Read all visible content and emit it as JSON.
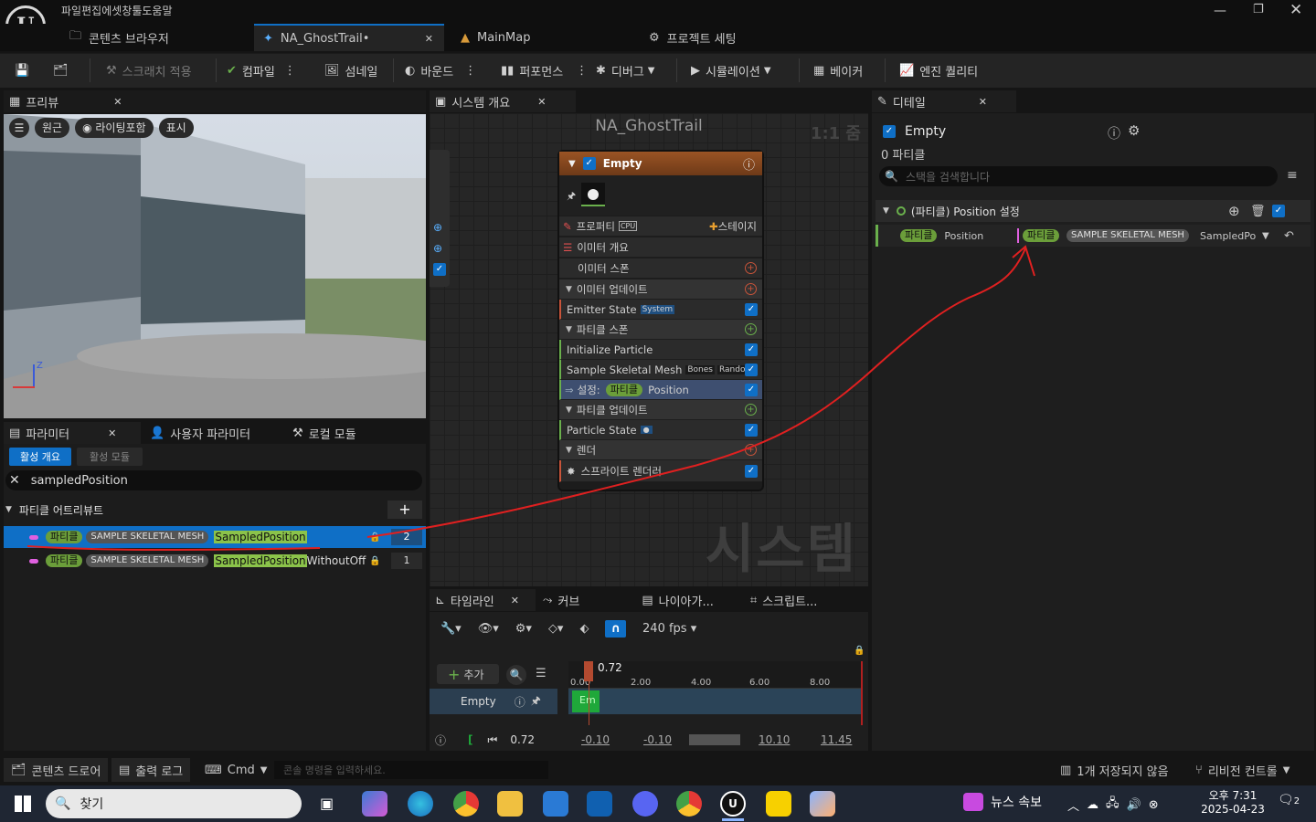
{
  "menu": [
    "파일",
    "편집",
    "에셋",
    "창",
    "툴",
    "도움말"
  ],
  "tabs": {
    "content_browser": "콘텐츠 브라우저",
    "active": "NA_GhostTrail•",
    "mainmap": "MainMap",
    "project_settings": "프로젝트 세팅"
  },
  "toolbar": {
    "scratch": "스크래치 적용",
    "compile": "컴파일",
    "thumbnail": "섬네일",
    "bounds": "바운드",
    "performance": "퍼포먼스",
    "debug": "디버그",
    "simulation": "시뮬레이션",
    "baker": "베이커",
    "engine_quality": "엔진 퀄리티"
  },
  "preview": {
    "tab": "프리뷰",
    "btn_perspective": "원근",
    "btn_lighting": "라이팅포함",
    "btn_show": "표시",
    "axis_z": "Z"
  },
  "params": {
    "tab_params": "파라미터",
    "tab_user": "사용자 파라미터",
    "tab_local": "로컬 모듈",
    "sub_active_overview": "활성 개요",
    "sub_active_modules": "활성 모듈",
    "search_value": "sampledPosition",
    "section": "파티클 어트리뷰트",
    "rows": [
      {
        "ns": "파티클",
        "src": "SAMPLE SKELETAL MESH",
        "hl": "SampledPosition",
        "rest": "",
        "count": "2"
      },
      {
        "ns": "파티클",
        "src": "SAMPLE SKELETAL MESH",
        "hl": "SampledPosition",
        "rest": "WithoutOff",
        "count": "1"
      }
    ]
  },
  "system": {
    "tab": "시스템 개요",
    "title": "NA_GhostTrail",
    "zoom": "1:1 줌",
    "watermark": "시스템",
    "node": {
      "title": "Empty",
      "properties": "프로퍼티",
      "cpu": "CPU",
      "stage": "스테이지",
      "emitter_summary": "이미터 개요",
      "emitter_spawn": "이미터 스폰",
      "emitter_update": "이미터 업데이트",
      "emitter_state": "Emitter State",
      "system_tag": "System",
      "particle_spawn": "파티클 스폰",
      "init_particle": "Initialize Particle",
      "sample_mesh": "Sample Skeletal Mesh",
      "bones": "Bones",
      "random": "Random",
      "set_label": "설정:",
      "set_ns": "파티클",
      "set_attr": "Position",
      "particle_update": "파티클 업데이트",
      "particle_state": "Particle State",
      "render": "렌더",
      "sprite_renderer": "스프라이트 렌더러"
    }
  },
  "details": {
    "tab": "디테일",
    "name": "Empty",
    "particles": "0 파티클",
    "search_placeholder": "스택을 검색합니다",
    "section": "(파티클) Position 설정",
    "row_ns": "파티클",
    "row_label": "Position",
    "val_ns": "파티클",
    "val_src": "SAMPLE SKELETAL MESH",
    "val_attr": "SampledPo"
  },
  "timeline": {
    "tab_timeline": "타임라인",
    "tab_curves": "커브",
    "tab_niagara": "나이아가...",
    "tab_script": "스크립트...",
    "fps": "240 fps",
    "add": "추가",
    "track": "Empty",
    "clip": "Em",
    "playhead": "0.72",
    "ticks": [
      "0.00",
      "2.00",
      "4.00",
      "6.00",
      "8.00"
    ],
    "current": "0.72",
    "v1": "-0.10",
    "v2": "-0.10",
    "v3": "10.10",
    "v4": "11.45"
  },
  "statusbar": {
    "content_drawer": "콘텐츠 드로어",
    "output_log": "출력 로그",
    "cmd": "Cmd",
    "console_placeholder": "콘솔 명령을 입력하세요.",
    "unsaved": "1개 저장되지 않음",
    "revision": "리비전 컨트롤"
  },
  "taskbar": {
    "search": "찾기",
    "news": "뉴스 속보",
    "time": "오후 7:31",
    "date": "2025-04-23",
    "notif": "2"
  },
  "colors": {
    "accent": "#0f6fc6",
    "annotation": "#e02020",
    "node_header": "#8a4a1e",
    "particle_chip": "#6b9e3a"
  }
}
